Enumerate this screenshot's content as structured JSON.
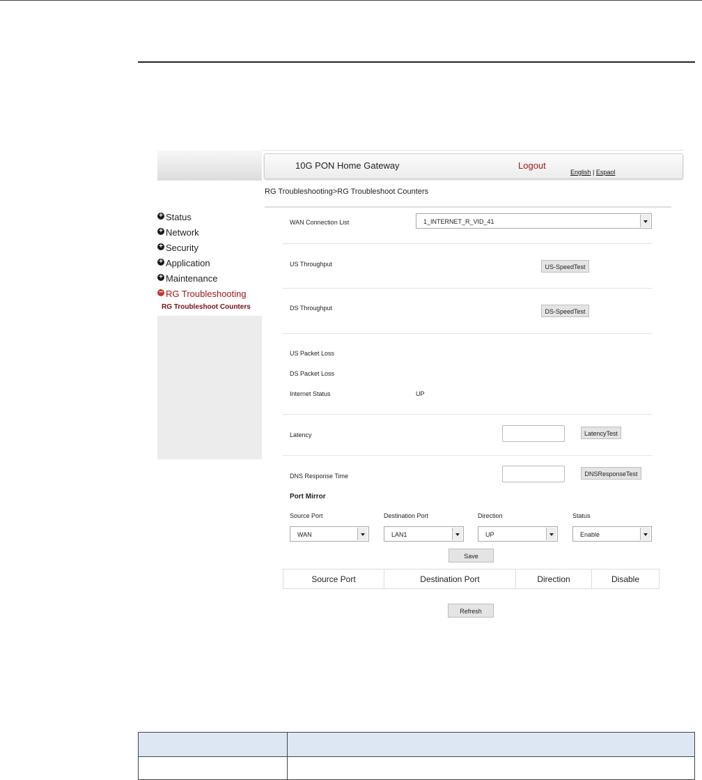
{
  "header": {
    "title": "10G PON Home Gateway",
    "logout": "Logout",
    "lang_english": "English",
    "lang_sep": " | ",
    "lang_spanish": "Espaol"
  },
  "sidebar": {
    "items": [
      {
        "label": "Status"
      },
      {
        "label": "Network"
      },
      {
        "label": "Security"
      },
      {
        "label": "Application"
      },
      {
        "label": "Maintenance"
      },
      {
        "label": "RG Troubleshooting"
      }
    ],
    "sub_item": "RG Troubleshoot Counters"
  },
  "breadcrumb": "RG Troubleshooting>RG Troubleshoot Counters",
  "wan": {
    "label": "WAN Connection List",
    "selected": "1_INTERNET_R_VID_41"
  },
  "throughput": {
    "us_label": "US Throughput",
    "us_button": "US-SpeedTest",
    "ds_label": "DS Throughput",
    "ds_button": "DS-SpeedTest"
  },
  "stats": {
    "us_loss_label": "US Packet Loss",
    "ds_loss_label": "DS Packet Loss",
    "internet_status_label": "Internet Status",
    "internet_status_value": "UP"
  },
  "latency": {
    "label": "Latency",
    "value": "",
    "button": "LatencyTest"
  },
  "dns": {
    "label": "DNS Response Time",
    "value": "",
    "button": "DNSResponseTest"
  },
  "port_mirror": {
    "title": "Port Mirror",
    "source_label": "Source Port",
    "source_value": "WAN",
    "dest_label": "Destination Port",
    "dest_value": "LAN1",
    "direction_label": "Direction",
    "direction_value": "UP",
    "status_label": "Status",
    "status_value": "Enable",
    "save_button": "Save",
    "table_headers": [
      "Source Port",
      "Destination Port",
      "Direction",
      "Disable"
    ],
    "refresh_button": "Refresh"
  },
  "colors": {
    "accent_red": "#a31616",
    "sub_item": "#7a0f14",
    "table_header_bg": "#dde6f3"
  }
}
